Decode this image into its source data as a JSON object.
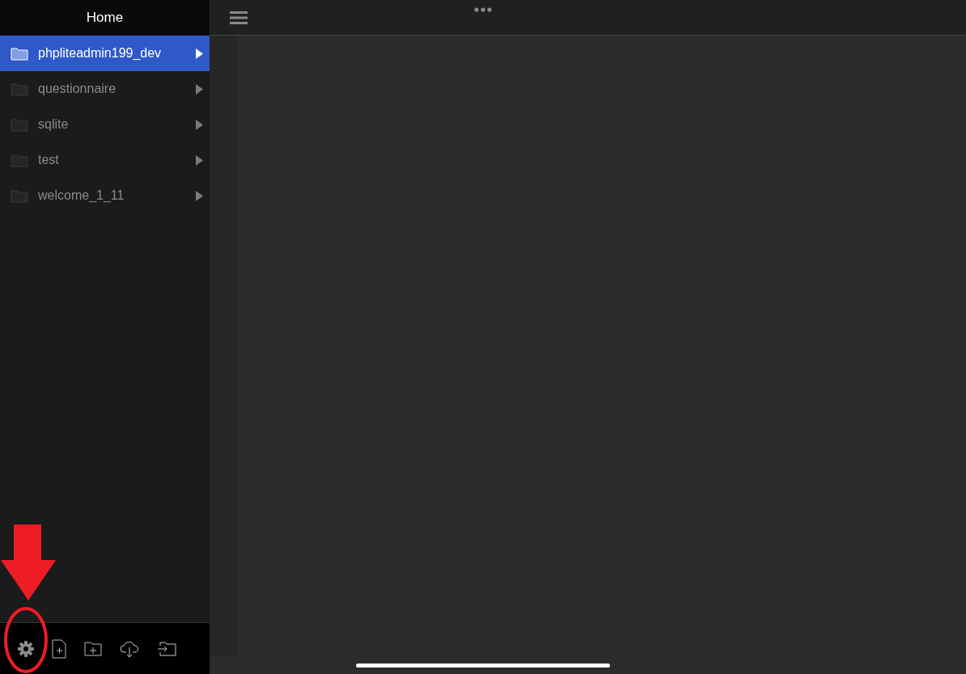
{
  "sidebar": {
    "title": "Home",
    "items": [
      {
        "name": "phpliteadmin199_dev",
        "selected": true
      },
      {
        "name": "questionnaire",
        "selected": false
      },
      {
        "name": "sqlite",
        "selected": false
      },
      {
        "name": "test",
        "selected": false
      },
      {
        "name": "welcome_1_11",
        "selected": false
      }
    ]
  }
}
